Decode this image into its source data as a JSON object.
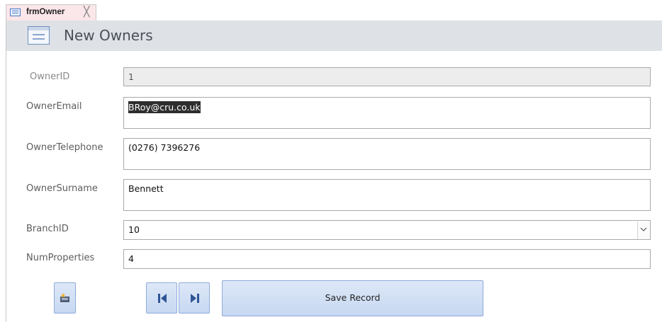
{
  "tab": {
    "label": "frmOwner",
    "close": "╳"
  },
  "header": {
    "title": "New Owners"
  },
  "fields": {
    "owner_id": {
      "label": "OwnerID",
      "value": "1"
    },
    "owner_email": {
      "label": "OwnerEmail",
      "value": "BRoy@cru.co.uk"
    },
    "owner_telephone": {
      "label": "OwnerTelephone",
      "value": "(0276) 7396276"
    },
    "owner_surname": {
      "label": "OwnerSurname",
      "value": "Bennett"
    },
    "branch_id": {
      "label": "BranchID",
      "value": "10"
    },
    "num_properties": {
      "label": "NumProperties",
      "value": "4"
    }
  },
  "buttons": {
    "new_record_icon": "new-record-icon",
    "first_record_icon": "first-record-icon",
    "last_record_icon": "last-record-icon",
    "save_label": "Save Record"
  },
  "colors": {
    "tab_bg": "#fbe6ea",
    "header_bg": "#dee1e6",
    "button_bg": "#c7d8f1",
    "selection_bg": "#2e2e2e"
  }
}
